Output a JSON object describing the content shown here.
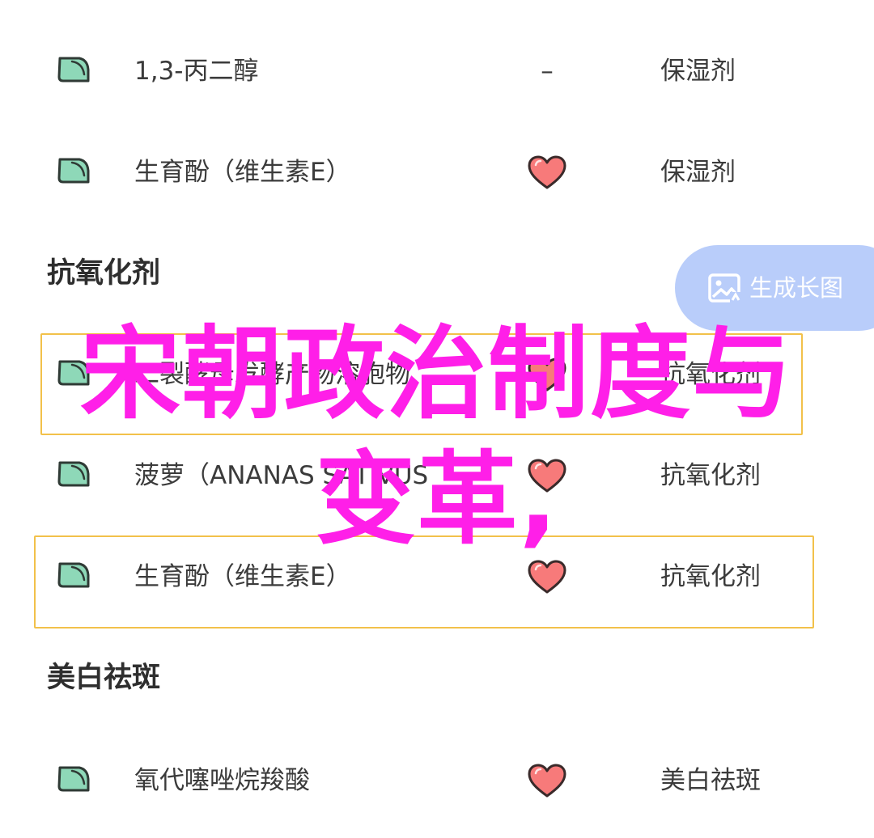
{
  "rows": [
    {
      "name": "1,3-丙二醇",
      "rating": "–",
      "has_heart": false,
      "function": "保湿剂"
    },
    {
      "name": "生育酚（维生素E）",
      "rating": "",
      "has_heart": true,
      "function": "保湿剂"
    },
    {
      "name": "二裂酵母发酵产物溶胞物",
      "rating": "",
      "has_heart": true,
      "function": "抗氧化剂"
    },
    {
      "name": "菠萝（ANANAS SATIVUS",
      "rating": "",
      "has_heart": true,
      "function": "抗氧化剂"
    },
    {
      "name": "生育酚（维生素E）",
      "rating": "",
      "has_heart": true,
      "function": "抗氧化剂"
    },
    {
      "name": "氧代噻唑烷羧酸",
      "rating": "",
      "has_heart": true,
      "function": "美白祛斑"
    }
  ],
  "sections": {
    "antioxidant": "抗氧化剂",
    "whitening": "美白祛斑"
  },
  "chart_button": {
    "label": "生成长图",
    "icon": "image-chart-icon"
  },
  "overlay_title": {
    "line1": "宋朝政治制度与",
    "line2": "变革,"
  },
  "colors": {
    "leaf_fill": "#8ed8b8",
    "leaf_stroke": "#2f3a35",
    "heart_fill": "#f77a7a",
    "heart_stroke": "#3a2a2a",
    "highlight_border": "#f2c14a",
    "chart_button_bg": "#b9cdfa",
    "overlay_text": "#ff1fe8"
  }
}
